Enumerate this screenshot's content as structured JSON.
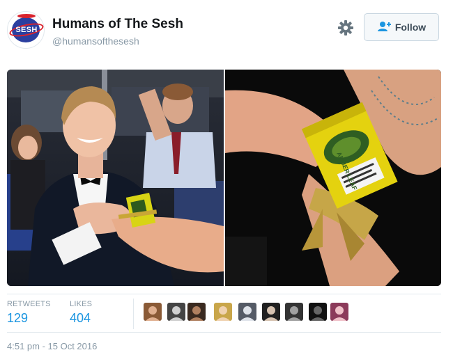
{
  "tweet": {
    "account_name": "Humans of The Sesh",
    "handle": "@humansofthesesh",
    "avatar_text": "SESH",
    "follow_label": "Follow",
    "timestamp": "4:51 pm - 15 Oct 2016"
  },
  "media": {
    "photo_left": "formal-party-photo",
    "photo_right": "wrist-tobacco-pouch-photo",
    "pouch_label": "AMBER LEAF"
  },
  "stats": {
    "retweets_label": "RETWEETS",
    "retweets_value": "129",
    "likes_label": "LIKES",
    "likes_value": "404"
  },
  "likers_count": 9,
  "icons": {
    "settings": "gear-icon",
    "follow": "add-user-icon"
  },
  "colors": {
    "link": "#1b95e0",
    "muted": "#8899a6",
    "border": "#e1e8ed"
  }
}
